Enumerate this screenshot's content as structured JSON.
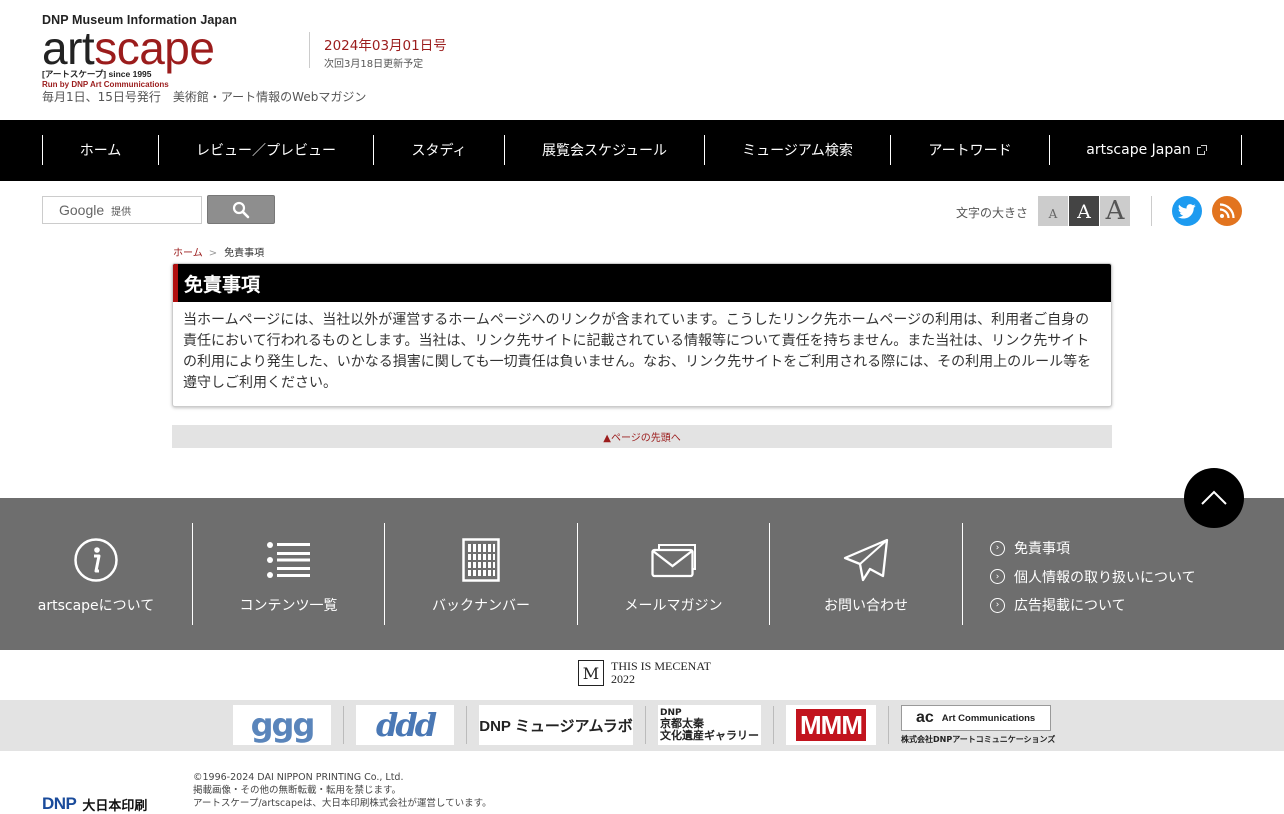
{
  "header": {
    "logo_top": "DNP Museum Information Japan",
    "logo_art": "art",
    "logo_scape": "scape",
    "logo_sub": "[アートスケープ] since 1995",
    "logo_by": "Run by DNP Art Communications",
    "tagline": "毎月1日、15日号発行　美術館・アート情報のWebマガジン",
    "issue_date": "2024年03月01日号",
    "next_update": "次回3月18日更新予定"
  },
  "nav": {
    "items": [
      {
        "label": "ホーム"
      },
      {
        "label": "レビュー／プレビュー"
      },
      {
        "label": "スタディ"
      },
      {
        "label": "展覧会スケジュール"
      },
      {
        "label": "ミュージアム検索"
      },
      {
        "label": "アートワード"
      },
      {
        "label": "artscape Japan"
      }
    ]
  },
  "search": {
    "brand": "Google",
    "provided": "提供"
  },
  "tools": {
    "font_size_label": "文字の大きさ",
    "font_small": "A",
    "font_medium": "A",
    "font_large": "A"
  },
  "breadcrumb": {
    "home": "ホーム",
    "separator": ">",
    "current": "免責事項"
  },
  "main": {
    "title": "免責事項",
    "body": "当ホームページには、当社以外が運営するホームページへのリンクが含まれています。こうしたリンク先ホームページの利用は、利用者ご自身の責任において行われるものとします。当社は、リンク先サイトに記載されている情報等について責任を持ちません。また当社は、リンク先サイトの利用により発生した、いかなる損害に関しても一切責任は負いません。なお、リンク先サイトをご利用される際には、その利用上のルール等を遵守しご利用ください。",
    "pagetop": "▲ページの先頭へ"
  },
  "footer": {
    "columns": [
      {
        "label": "artscapeについて",
        "icon": "info-icon"
      },
      {
        "label": "コンテンツ一覧",
        "icon": "list-icon"
      },
      {
        "label": "バックナンバー",
        "icon": "archive-icon"
      },
      {
        "label": "メールマガジン",
        "icon": "mail-icon"
      },
      {
        "label": "お問い合わせ",
        "icon": "paper-plane-icon"
      }
    ],
    "links": [
      {
        "label": "免責事項"
      },
      {
        "label": "個人情報の取り扱いについて"
      },
      {
        "label": "広告掲載について"
      }
    ]
  },
  "mecenat": {
    "line1": "THIS IS MECENAT",
    "line2": "2022"
  },
  "partners": {
    "ggg": "ggg",
    "ddd": "ddd",
    "dnp_lab": "DNP ミュージアムラボ",
    "kyoto_dnp": "DNP",
    "kyoto_line1": "京都太秦",
    "kyoto_line2": "文化遺産ギャラリー",
    "mmm": "MMM",
    "artcom_mark": "ac",
    "artcom_name": "Art Communications",
    "artcom_sub": "株式会社DNPアートコミュニケーションズ"
  },
  "bottom": {
    "dnp_mark": "DNP",
    "dnp_jp": "大日本印刷",
    "copy1": "©1996-2024 DAI NIPPON PRINTING Co., Ltd.",
    "copy2": "掲載画像・その他の無断転載・転用を禁じます。",
    "copy3": "アートスケープ/artscapeは、大日本印刷株式会社が運営しています。"
  },
  "colors": {
    "brand_red": "#9b1c1c",
    "nav_bg": "#000000",
    "footer_bg": "#6e6e6e",
    "twitter": "#1d9bf0",
    "rss": "#e2741f"
  }
}
